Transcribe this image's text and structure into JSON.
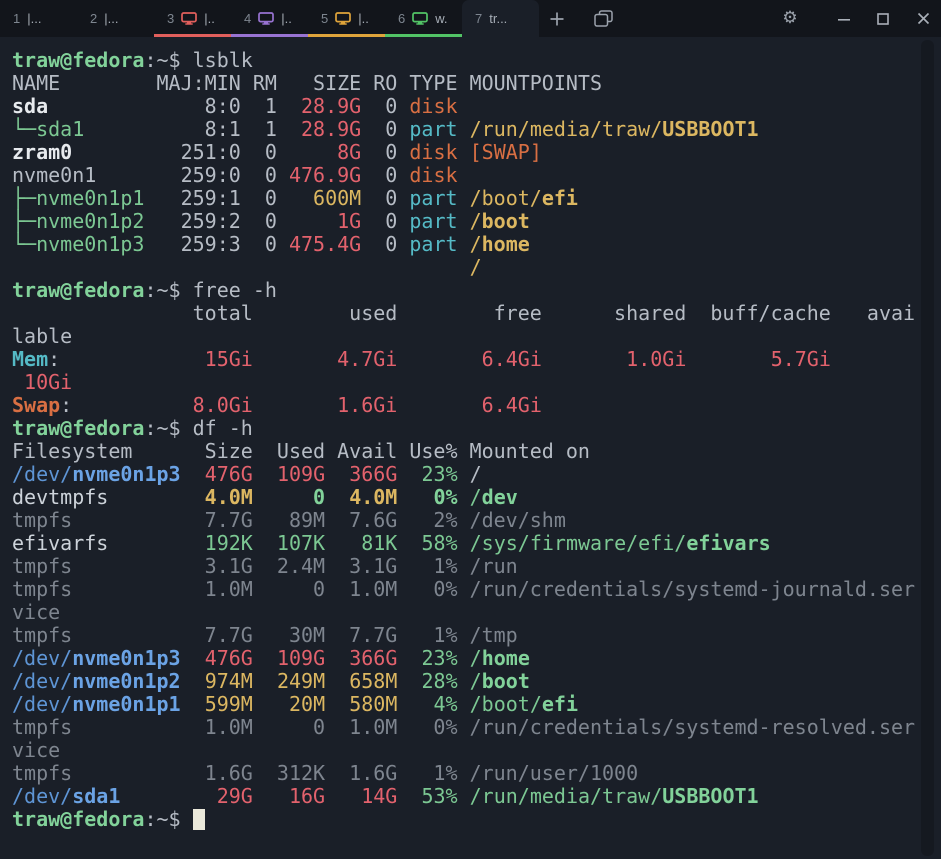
{
  "window": {
    "app": "terminal",
    "tabs": [
      {
        "number": "1",
        "title": "|...",
        "color": null,
        "active": false
      },
      {
        "number": "2",
        "title": "|...",
        "color": null,
        "active": false
      },
      {
        "number": "3",
        "title": "|..",
        "color": "#e15f5c",
        "icon": "monitor-icon",
        "active": false
      },
      {
        "number": "4",
        "title": "|..",
        "color": "#9873d2",
        "icon": "monitor-icon",
        "active": false
      },
      {
        "number": "5",
        "title": "|..",
        "color": "#dfa43b",
        "icon": "monitor-icon",
        "active": false
      },
      {
        "number": "6",
        "title": "w.",
        "color": "#52c466",
        "icon": "monitor-icon",
        "active": false
      },
      {
        "number": "7",
        "title": "tr...",
        "color": null,
        "active": true
      }
    ],
    "buttons": [
      "new-tab",
      "tab-overview",
      "settings",
      "minimize",
      "maximize",
      "close"
    ]
  },
  "palette": {
    "background": "#1a1f28",
    "topbar": "#12151b",
    "foreground": "#b6bcc5",
    "dim": "#7e858f",
    "green": "#7cc893",
    "red": "#e3626d",
    "orange": "#d96f43",
    "yellow": "#dcb761",
    "cyan": "#55bac6",
    "blue": "#5e95d5",
    "cursor": "#eae8da"
  },
  "terminal": {
    "prompt": "traw@fedora:~$",
    "commands": [
      "lsblk",
      "free -h",
      "df -h"
    ],
    "lines": [
      {
        "segs": [
          [
            "grnb",
            "traw@fedora"
          ],
          [
            "fg",
            ":~$ lsblk"
          ]
        ]
      },
      {
        "segs": [
          [
            "fg",
            "NAME        MAJ:MIN RM   SIZE RO TYPE MOUNTPOINTS"
          ]
        ]
      },
      {
        "segs": [
          [
            "wht",
            "sda"
          ],
          [
            "fg",
            "             8:0  1  "
          ],
          [
            "red",
            "28.9G"
          ],
          [
            "fg",
            "  0 "
          ],
          [
            "org",
            "disk"
          ]
        ]
      },
      {
        "segs": [
          [
            "grn",
            "└─sda1"
          ],
          [
            "fg",
            "          8:1  1  "
          ],
          [
            "red",
            "28.9G"
          ],
          [
            "fg",
            "  0 "
          ],
          [
            "cyn",
            "part"
          ],
          [
            "fg",
            " "
          ],
          [
            "yel",
            "/run/media/traw/"
          ],
          [
            "yelb",
            "USBBOOT1"
          ]
        ]
      },
      {
        "segs": [
          [
            "wht",
            "zram0"
          ],
          [
            "fg",
            "         251:0  0     "
          ],
          [
            "red",
            "8G"
          ],
          [
            "fg",
            "  0 "
          ],
          [
            "org",
            "disk"
          ],
          [
            "fg",
            " "
          ],
          [
            "org",
            "[SWAP]"
          ]
        ]
      },
      {
        "segs": [
          [
            "fg",
            "nvme0n1       259:0  0 "
          ],
          [
            "red",
            "476.9G"
          ],
          [
            "fg",
            "  0 "
          ],
          [
            "org",
            "disk"
          ]
        ]
      },
      {
        "segs": [
          [
            "grn",
            "├─nvme0n1p1"
          ],
          [
            "fg",
            "   259:1  0   "
          ],
          [
            "yel",
            "600M"
          ],
          [
            "fg",
            "  0 "
          ],
          [
            "cyn",
            "part"
          ],
          [
            "fg",
            " "
          ],
          [
            "yel",
            "/boot/"
          ],
          [
            "yelb",
            "efi"
          ]
        ]
      },
      {
        "segs": [
          [
            "grn",
            "├─nvme0n1p2"
          ],
          [
            "fg",
            "   259:2  0     "
          ],
          [
            "red",
            "1G"
          ],
          [
            "fg",
            "  0 "
          ],
          [
            "cyn",
            "part"
          ],
          [
            "fg",
            " "
          ],
          [
            "yel",
            "/"
          ],
          [
            "yelb",
            "boot"
          ]
        ]
      },
      {
        "segs": [
          [
            "grn",
            "└─nvme0n1p3"
          ],
          [
            "fg",
            "   259:3  0 "
          ],
          [
            "red",
            "475.4G"
          ],
          [
            "fg",
            "  0 "
          ],
          [
            "cyn",
            "part"
          ],
          [
            "fg",
            " "
          ],
          [
            "yel",
            "/"
          ],
          [
            "yelb",
            "home"
          ]
        ]
      },
      {
        "segs": [
          [
            "fg",
            "                                      "
          ],
          [
            "yel",
            "/"
          ]
        ]
      },
      {
        "segs": [
          [
            "grnb",
            "traw@fedora"
          ],
          [
            "fg",
            ":~$ free -h"
          ]
        ]
      },
      {
        "segs": [
          [
            "fg",
            "               total        used        free      shared  buff/cache   avai"
          ]
        ]
      },
      {
        "segs": [
          [
            "fg",
            "lable"
          ]
        ]
      },
      {
        "segs": [
          [
            "cynb",
            "Mem"
          ],
          [
            "fg",
            ":            "
          ],
          [
            "red",
            "15Gi"
          ],
          [
            "fg",
            "       "
          ],
          [
            "red",
            "4.7Gi"
          ],
          [
            "fg",
            "       "
          ],
          [
            "red",
            "6.4Gi"
          ],
          [
            "fg",
            "       "
          ],
          [
            "red",
            "1.0Gi"
          ],
          [
            "fg",
            "       "
          ],
          [
            "red",
            "5.7Gi"
          ]
        ]
      },
      {
        "segs": [
          [
            "fg",
            " "
          ],
          [
            "red",
            "10Gi"
          ]
        ]
      },
      {
        "segs": [
          [
            "orgb",
            "Swap"
          ],
          [
            "fg",
            ":          "
          ],
          [
            "red",
            "8.0Gi"
          ],
          [
            "fg",
            "       "
          ],
          [
            "red",
            "1.6Gi"
          ],
          [
            "fg",
            "       "
          ],
          [
            "red",
            "6.4Gi"
          ]
        ]
      },
      {
        "segs": [
          [
            "grnb",
            "traw@fedora"
          ],
          [
            "fg",
            ":~$ df -h"
          ]
        ]
      },
      {
        "segs": [
          [
            "fg",
            "Filesystem      Size  Used Avail Use% Mounted on"
          ]
        ]
      },
      {
        "segs": [
          [
            "blu",
            "/dev/"
          ],
          [
            "blub",
            "nvme0n1p3"
          ],
          [
            "fg",
            "  "
          ],
          [
            "red",
            "476G"
          ],
          [
            "fg",
            "  "
          ],
          [
            "red",
            "109G"
          ],
          [
            "fg",
            "  "
          ],
          [
            "red",
            "366G"
          ],
          [
            "fg",
            "  "
          ],
          [
            "grn",
            "23%"
          ],
          [
            "fg",
            " /"
          ]
        ]
      },
      {
        "segs": [
          [
            "whtn",
            "devtmpfs"
          ],
          [
            "fg",
            "        "
          ],
          [
            "yelb",
            "4.0M"
          ],
          [
            "fg",
            "     "
          ],
          [
            "grnb",
            "0"
          ],
          [
            "fg",
            "  "
          ],
          [
            "yelb",
            "4.0M"
          ],
          [
            "fg",
            "   "
          ],
          [
            "grnb",
            "0%"
          ],
          [
            "fg",
            " "
          ],
          [
            "grn",
            "/"
          ],
          [
            "grnb",
            "dev"
          ]
        ]
      },
      {
        "segs": [
          [
            "dim",
            "tmpfs           7.7G   89M  7.6G   2% /dev/shm"
          ]
        ]
      },
      {
        "segs": [
          [
            "whtn",
            "efivarfs"
          ],
          [
            "fg",
            "        "
          ],
          [
            "grn",
            "192K"
          ],
          [
            "fg",
            "  "
          ],
          [
            "grn",
            "107K"
          ],
          [
            "fg",
            "   "
          ],
          [
            "grn",
            "81K"
          ],
          [
            "fg",
            "  "
          ],
          [
            "grn",
            "58%"
          ],
          [
            "fg",
            " "
          ],
          [
            "grn",
            "/sys/firmware/efi/"
          ],
          [
            "grnb",
            "efivars"
          ]
        ]
      },
      {
        "segs": [
          [
            "dim",
            "tmpfs           3.1G  2.4M  3.1G   1% /run"
          ]
        ]
      },
      {
        "segs": [
          [
            "dim",
            "tmpfs           1.0M     0  1.0M   0% /run/credentials/systemd-journald.ser"
          ]
        ]
      },
      {
        "segs": [
          [
            "dim",
            "vice"
          ]
        ]
      },
      {
        "segs": [
          [
            "dim",
            "tmpfs           7.7G   30M  7.7G   1% /tmp"
          ]
        ]
      },
      {
        "segs": [
          [
            "blu",
            "/dev/"
          ],
          [
            "blub",
            "nvme0n1p3"
          ],
          [
            "fg",
            "  "
          ],
          [
            "red",
            "476G"
          ],
          [
            "fg",
            "  "
          ],
          [
            "red",
            "109G"
          ],
          [
            "fg",
            "  "
          ],
          [
            "red",
            "366G"
          ],
          [
            "fg",
            "  "
          ],
          [
            "grn",
            "23%"
          ],
          [
            "fg",
            " "
          ],
          [
            "grn",
            "/"
          ],
          [
            "grnb",
            "home"
          ]
        ]
      },
      {
        "segs": [
          [
            "blu",
            "/dev/"
          ],
          [
            "blub",
            "nvme0n1p2"
          ],
          [
            "fg",
            "  "
          ],
          [
            "yel",
            "974M"
          ],
          [
            "fg",
            "  "
          ],
          [
            "yel",
            "249M"
          ],
          [
            "fg",
            "  "
          ],
          [
            "yel",
            "658M"
          ],
          [
            "fg",
            "  "
          ],
          [
            "grn",
            "28%"
          ],
          [
            "fg",
            " "
          ],
          [
            "grn",
            "/"
          ],
          [
            "grnb",
            "boot"
          ]
        ]
      },
      {
        "segs": [
          [
            "blu",
            "/dev/"
          ],
          [
            "blub",
            "nvme0n1p1"
          ],
          [
            "fg",
            "  "
          ],
          [
            "yel",
            "599M"
          ],
          [
            "fg",
            "   "
          ],
          [
            "yel",
            "20M"
          ],
          [
            "fg",
            "  "
          ],
          [
            "yel",
            "580M"
          ],
          [
            "fg",
            "   "
          ],
          [
            "grn",
            "4%"
          ],
          [
            "fg",
            " "
          ],
          [
            "grn",
            "/boot/"
          ],
          [
            "grnb",
            "efi"
          ]
        ]
      },
      {
        "segs": [
          [
            "dim",
            "tmpfs           1.0M     0  1.0M   0% /run/credentials/systemd-resolved.ser"
          ]
        ]
      },
      {
        "segs": [
          [
            "dim",
            "vice"
          ]
        ]
      },
      {
        "segs": [
          [
            "dim",
            "tmpfs           1.6G  312K  1.6G   1% /run/user/1000"
          ]
        ]
      },
      {
        "segs": [
          [
            "blu",
            "/dev/"
          ],
          [
            "blub",
            "sda1"
          ],
          [
            "fg",
            "        "
          ],
          [
            "red",
            "29G"
          ],
          [
            "fg",
            "   "
          ],
          [
            "red",
            "16G"
          ],
          [
            "fg",
            "   "
          ],
          [
            "red",
            "14G"
          ],
          [
            "fg",
            "  "
          ],
          [
            "grn",
            "53%"
          ],
          [
            "fg",
            " "
          ],
          [
            "grn",
            "/run/media/traw/"
          ],
          [
            "grnb",
            "USBBOOT1"
          ]
        ]
      },
      {
        "segs": [
          [
            "grnb",
            "traw@fedora"
          ],
          [
            "fg",
            ":~$ "
          ]
        ],
        "cursor": true
      }
    ]
  }
}
